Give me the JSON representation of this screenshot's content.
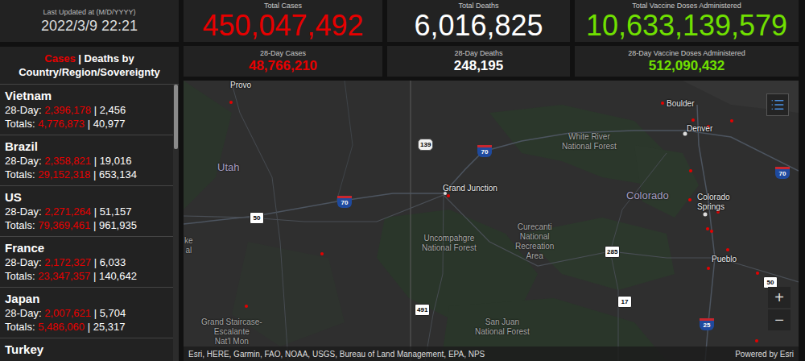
{
  "header": {
    "last_updated_label": "Last Updated at (M/D/YYYY)",
    "last_updated": "2022/3/9 22:21"
  },
  "totals": [
    {
      "label": "Total Cases",
      "value": "450,047,492",
      "color": "#e60000"
    },
    {
      "label": "Total Deaths",
      "value": "6,016,825",
      "color": "#ffffff"
    },
    {
      "label": "Total Vaccine Doses Administered",
      "value": "10,633,139,579",
      "color": "#70e000"
    }
  ],
  "recent": [
    {
      "label": "28-Day Cases",
      "value": "48,766,210",
      "color": "#e60000"
    },
    {
      "label": "28-Day Deaths",
      "value": "248,195",
      "color": "#ffffff"
    },
    {
      "label": "28-Day Vaccine Doses Administered",
      "value": "512,090,432",
      "color": "#70e000"
    }
  ],
  "sidebar": {
    "title_cases": "Cases",
    "title_separator": "|",
    "title_rest": "Deaths by Country/Region/Sovereignty",
    "recent_label": "28-Day:",
    "totals_label": "Totals:",
    "separator": "|",
    "scrollbar": {
      "level": 0
    },
    "countries": [
      {
        "name": "Vietnam",
        "recent_cases": "2,396,178",
        "recent_deaths": "2,456",
        "total_cases": "4,776,873",
        "total_deaths": "40,977"
      },
      {
        "name": "Brazil",
        "recent_cases": "2,358,821",
        "recent_deaths": "19,016",
        "total_cases": "29,152,318",
        "total_deaths": "653,134"
      },
      {
        "name": "US",
        "recent_cases": "2,271,264",
        "recent_deaths": "51,157",
        "total_cases": "79,369,461",
        "total_deaths": "961,935"
      },
      {
        "name": "France",
        "recent_cases": "2,172,327",
        "recent_deaths": "6,033",
        "total_cases": "23,347,357",
        "total_deaths": "140,642"
      },
      {
        "name": "Japan",
        "recent_cases": "2,007,621",
        "recent_deaths": "5,704",
        "total_cases": "5,486,060",
        "total_deaths": "25,317"
      },
      {
        "name": "Turkey"
      }
    ]
  },
  "map": {
    "labels": [
      {
        "lines": [
          "Provo"
        ],
        "kind": "city"
      },
      {
        "lines": [
          "Boulder"
        ],
        "kind": "city"
      },
      {
        "lines": [
          "Denver"
        ],
        "kind": "city"
      },
      {
        "lines": [
          "White River",
          "National Forest"
        ],
        "kind": "park"
      },
      {
        "lines": [
          "Utah"
        ],
        "kind": "region"
      },
      {
        "lines": [
          "Grand Junction"
        ],
        "kind": "city"
      },
      {
        "lines": [
          "Colorado"
        ],
        "kind": "region"
      },
      {
        "lines": [
          "Colorado",
          "Springs"
        ],
        "kind": "city"
      },
      {
        "lines": [
          "Uncompahgre",
          "National Forest"
        ],
        "kind": "park"
      },
      {
        "lines": [
          "Curecanti",
          "National",
          "Recreation",
          "Area"
        ],
        "kind": "park"
      },
      {
        "lines": [
          "Pueblo"
        ],
        "kind": "city"
      },
      {
        "lines": [
          "Grand Staircase-",
          "Escalante",
          "Nat'l Mon"
        ],
        "kind": "park"
      },
      {
        "lines": [
          "San Juan",
          "National Forest"
        ],
        "kind": "park"
      },
      {
        "lines": [
          "ke",
          "al"
        ],
        "kind": "park"
      }
    ],
    "shields": [
      {
        "text": "139",
        "kind": "state"
      },
      {
        "text": "70",
        "kind": "interstate"
      },
      {
        "text": "70",
        "kind": "interstate"
      },
      {
        "text": "50",
        "kind": "us"
      },
      {
        "text": "70",
        "kind": "interstate"
      },
      {
        "text": "285",
        "kind": "us"
      },
      {
        "text": "17",
        "kind": "us"
      },
      {
        "text": "491",
        "kind": "us"
      },
      {
        "text": "25",
        "kind": "interstate"
      },
      {
        "text": "50",
        "kind": "us"
      }
    ],
    "zoom": [
      "+",
      "−"
    ],
    "attribution": "Esri, HERE, Garmin, FAO, NOAA, USGS, Bureau of Land Management, EPA, NPS",
    "powered_by": "Powered by Esri"
  }
}
